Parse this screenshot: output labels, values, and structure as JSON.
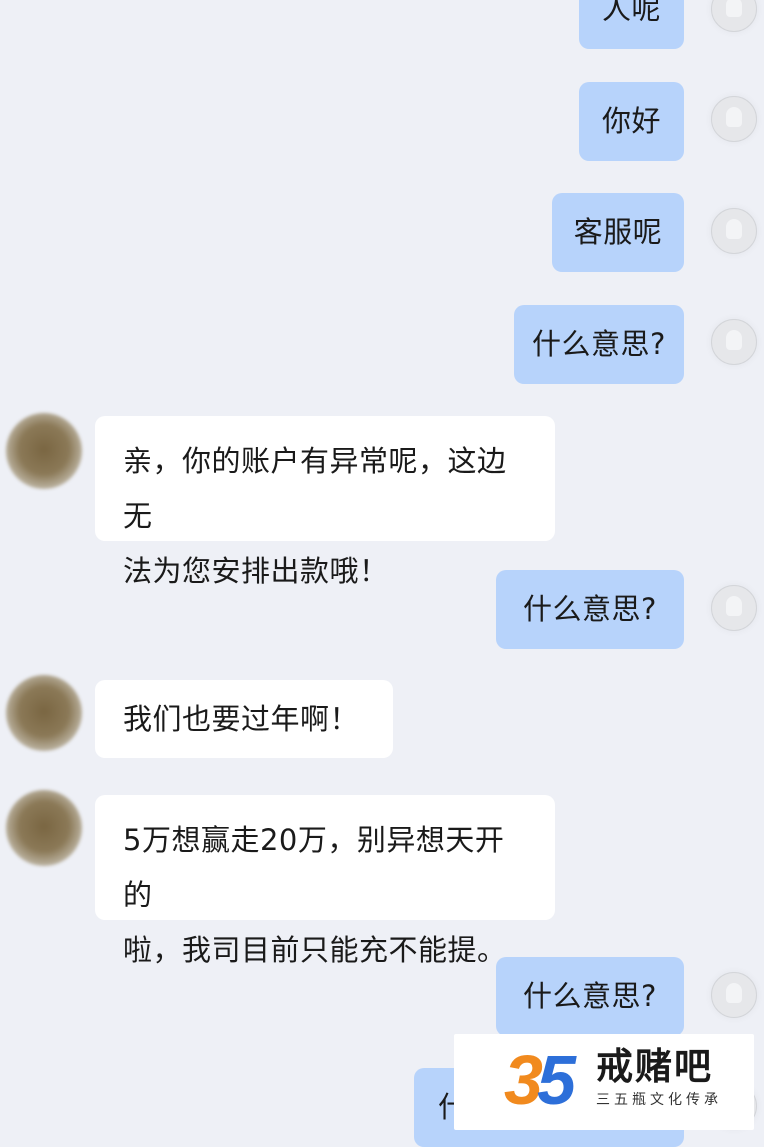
{
  "messages": [
    {
      "side": "out",
      "text": "人呢"
    },
    {
      "side": "out",
      "text": "你好"
    },
    {
      "side": "out",
      "text": "客服呢"
    },
    {
      "side": "out",
      "text": "什么意思?"
    },
    {
      "side": "in",
      "text": "亲，你的账户有异常呢，这边无\n法为您安排出款哦！"
    },
    {
      "side": "out",
      "text": "什么意思?"
    },
    {
      "side": "in",
      "text": "我们也要过年啊！"
    },
    {
      "side": "in",
      "text": "5万想赢走20万，别异想天开的\n啦，我司目前只能充不能提。"
    },
    {
      "side": "out",
      "text": "什么意思?"
    },
    {
      "side": "out",
      "text": "什么意思？黑钱吗"
    }
  ],
  "watermark": {
    "digit1": "3",
    "digit2": "5",
    "title": "戒赌吧",
    "subtitle": "三五瓶文化传承",
    "colors": {
      "three": "#f18a1e",
      "five": "#2d6fd9"
    }
  }
}
